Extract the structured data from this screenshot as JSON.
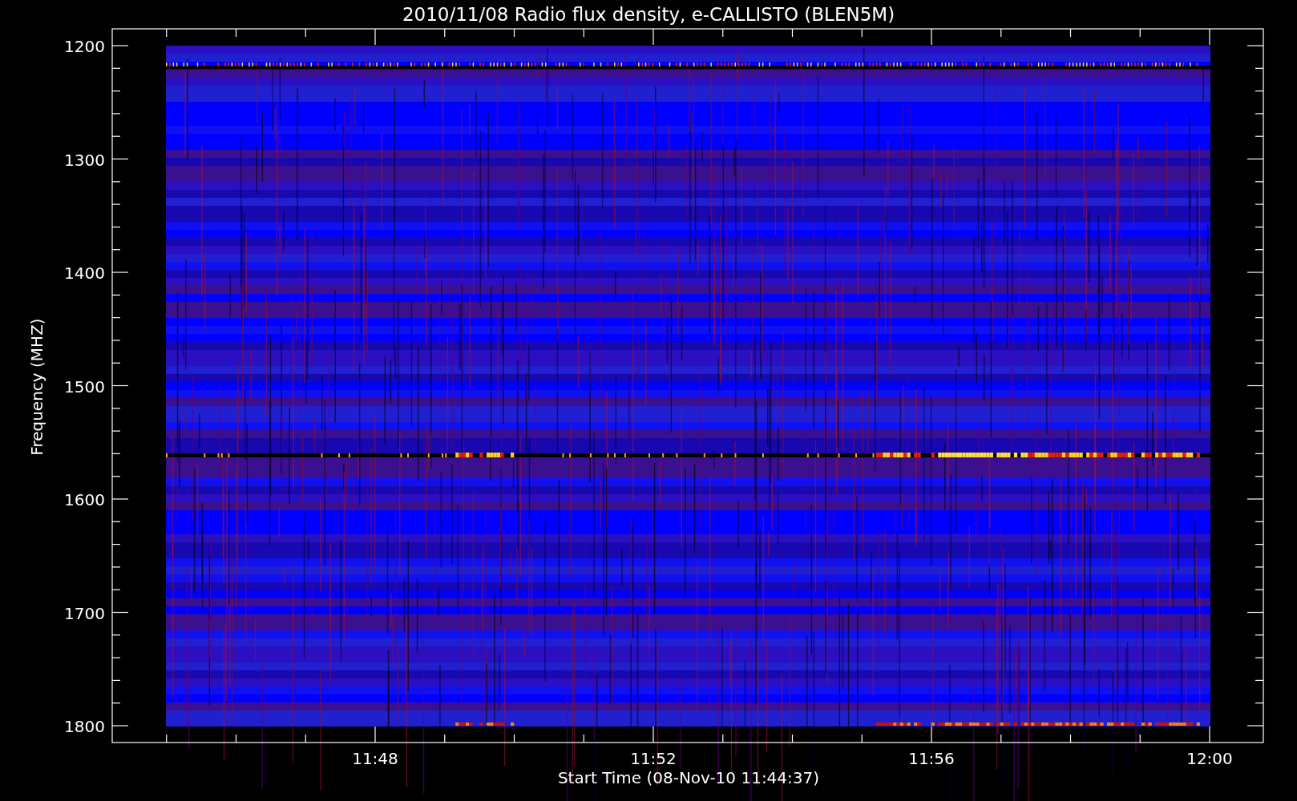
{
  "title": "2010/11/08  Radio flux density, e-CALLISTO (BLEN5M)",
  "y_axis": {
    "label": "Frequency (MHZ)",
    "ticks": [
      "1200",
      "1300",
      "1400",
      "1500",
      "1600",
      "1700",
      "1800"
    ]
  },
  "x_axis": {
    "label": "Start Time (08-Nov-10 11:44:37)",
    "ticks": [
      "11:48",
      "11:52",
      "11:56",
      "12:00"
    ]
  }
}
